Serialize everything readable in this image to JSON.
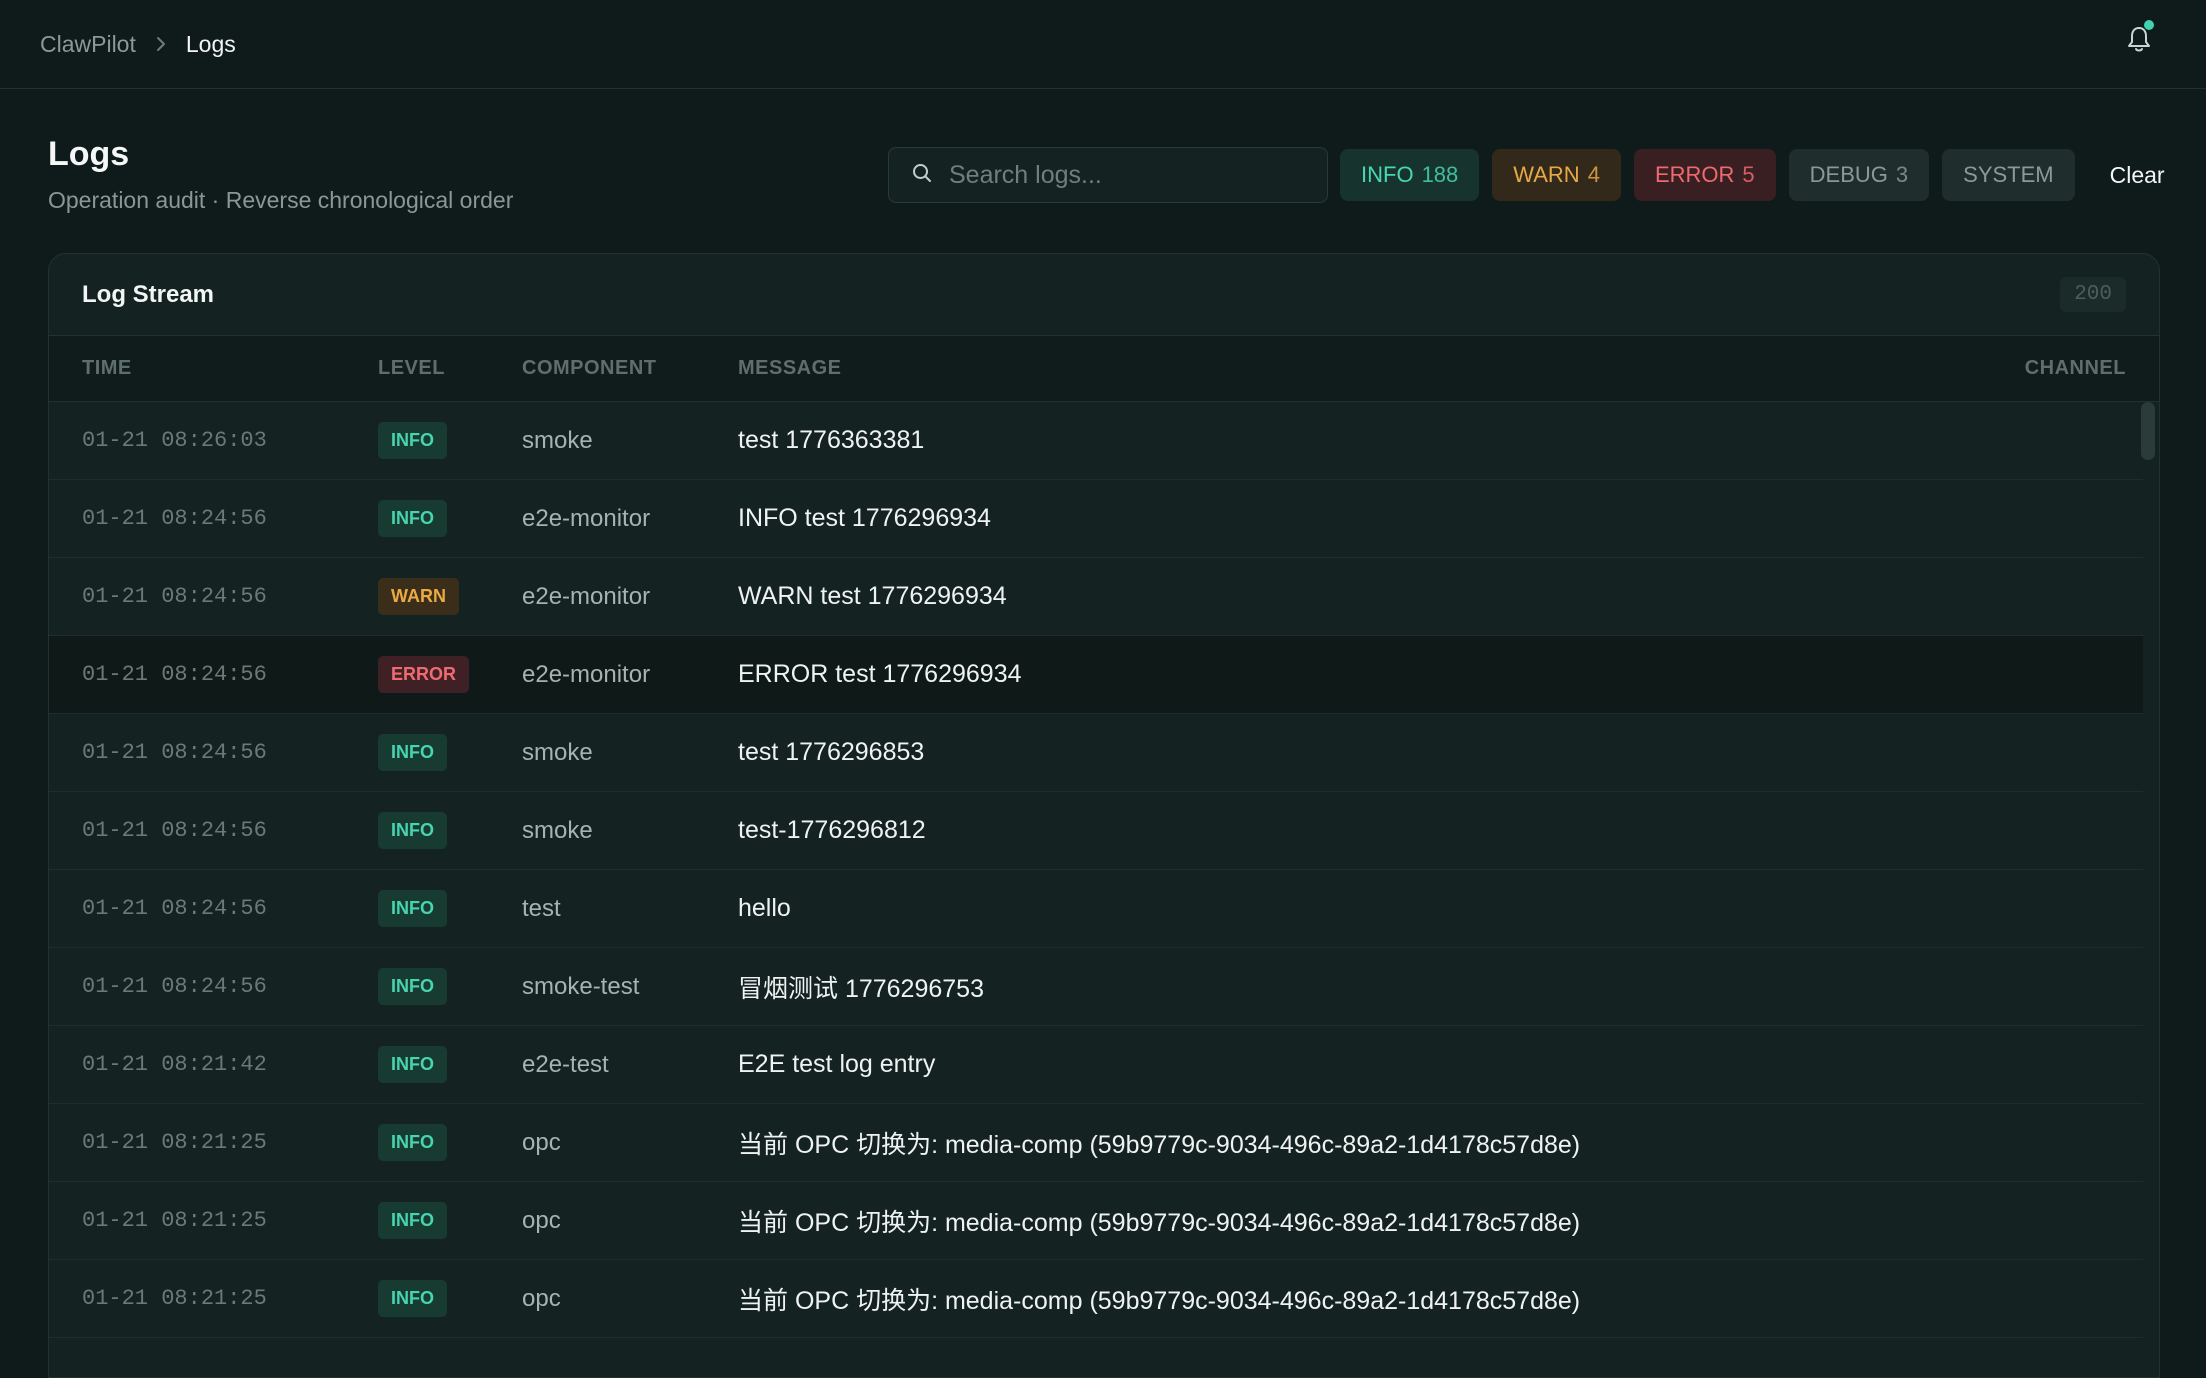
{
  "breadcrumb": {
    "root": "ClawPilot",
    "current": "Logs"
  },
  "header": {
    "title": "Logs",
    "subtitle": "Operation audit · Reverse chronological order"
  },
  "search": {
    "placeholder": "Search logs...",
    "value": ""
  },
  "filters": [
    {
      "label": "INFO",
      "count": "188"
    },
    {
      "label": "WARN",
      "count": "4"
    },
    {
      "label": "ERROR",
      "count": "5"
    },
    {
      "label": "DEBUG",
      "count": "3"
    },
    {
      "label": "SYSTEM",
      "count": ""
    }
  ],
  "clear_label": "Clear",
  "stream": {
    "title": "Log Stream",
    "count": "200",
    "columns": {
      "time": "TIME",
      "level": "LEVEL",
      "component": "COMPONENT",
      "message": "MESSAGE",
      "channel": "CHANNEL"
    },
    "rows": [
      {
        "time": "01-21 08:26:03",
        "level": "INFO",
        "component": "smoke",
        "message": "test 1776363381",
        "channel": ""
      },
      {
        "time": "01-21 08:24:56",
        "level": "INFO",
        "component": "e2e-monitor",
        "message": "INFO test 1776296934",
        "channel": ""
      },
      {
        "time": "01-21 08:24:56",
        "level": "WARN",
        "component": "e2e-monitor",
        "message": "WARN test 1776296934",
        "channel": ""
      },
      {
        "time": "01-21 08:24:56",
        "level": "ERROR",
        "component": "e2e-monitor",
        "message": "ERROR test 1776296934",
        "channel": ""
      },
      {
        "time": "01-21 08:24:56",
        "level": "INFO",
        "component": "smoke",
        "message": "test 1776296853",
        "channel": ""
      },
      {
        "time": "01-21 08:24:56",
        "level": "INFO",
        "component": "smoke",
        "message": "test-1776296812",
        "channel": ""
      },
      {
        "time": "01-21 08:24:56",
        "level": "INFO",
        "component": "test",
        "message": "hello",
        "channel": ""
      },
      {
        "time": "01-21 08:24:56",
        "level": "INFO",
        "component": "smoke-test",
        "message": "冒烟测试 1776296753",
        "channel": ""
      },
      {
        "time": "01-21 08:21:42",
        "level": "INFO",
        "component": "e2e-test",
        "message": "E2E test log entry",
        "channel": ""
      },
      {
        "time": "01-21 08:21:25",
        "level": "INFO",
        "component": "opc",
        "message": "当前 OPC 切换为: media-comp (59b9779c-9034-496c-89a2-1d4178c57d8e)",
        "channel": ""
      },
      {
        "time": "01-21 08:21:25",
        "level": "INFO",
        "component": "opc",
        "message": "当前 OPC 切换为: media-comp (59b9779c-9034-496c-89a2-1d4178c57d8e)",
        "channel": ""
      },
      {
        "time": "01-21 08:21:25",
        "level": "INFO",
        "component": "opc",
        "message": "当前 OPC 切换为: media-comp (59b9779c-9034-496c-89a2-1d4178c57d8e)",
        "channel": ""
      }
    ]
  }
}
